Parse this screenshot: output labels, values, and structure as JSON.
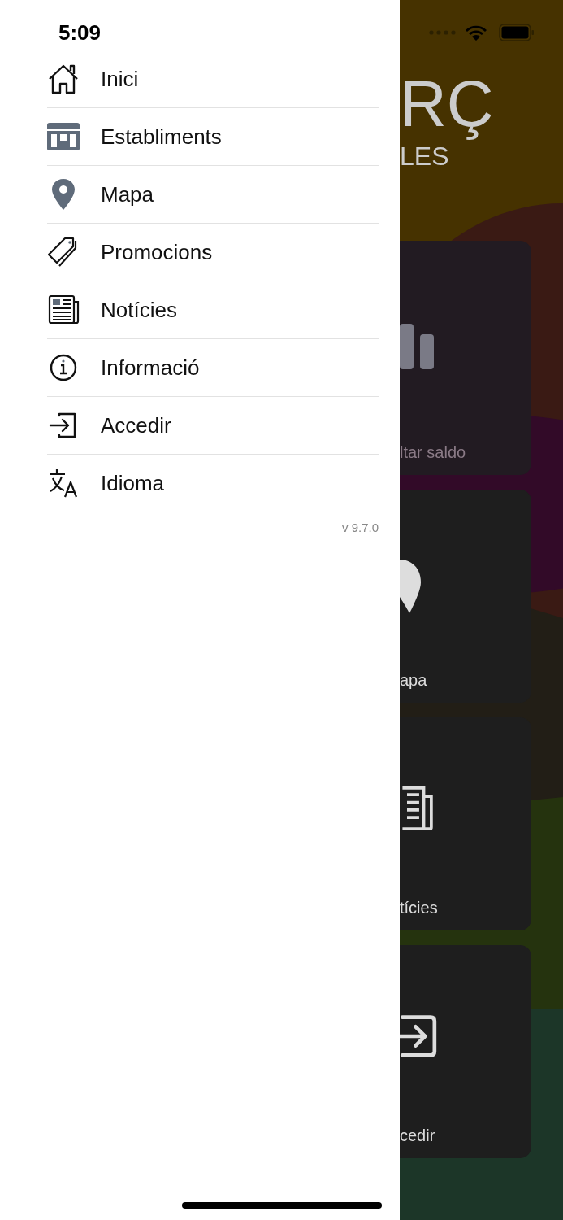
{
  "status_bar": {
    "time": "5:09"
  },
  "menu": {
    "items": [
      {
        "label": "Inici",
        "kind": "home"
      },
      {
        "label": "Establiments",
        "kind": "store"
      },
      {
        "label": "Mapa",
        "kind": "pin"
      },
      {
        "label": "Promocions",
        "kind": "tag"
      },
      {
        "label": "Notícies",
        "kind": "news"
      },
      {
        "label": "Informació",
        "kind": "info"
      },
      {
        "label": "Accedir",
        "kind": "login"
      },
      {
        "label": "Idioma",
        "kind": "language"
      }
    ],
    "version": "v 9.7.0"
  },
  "background_app": {
    "logo": "RÇ",
    "logo_subtitle": "LES",
    "cards": [
      {
        "label": "ltar saldo",
        "kind": "chart",
        "dimmed": true
      },
      {
        "label": "apa",
        "kind": "pin",
        "dimmed": false
      },
      {
        "label": "tícies",
        "kind": "news",
        "dimmed": false
      },
      {
        "label": "cedir",
        "kind": "login",
        "dimmed": false
      }
    ]
  }
}
